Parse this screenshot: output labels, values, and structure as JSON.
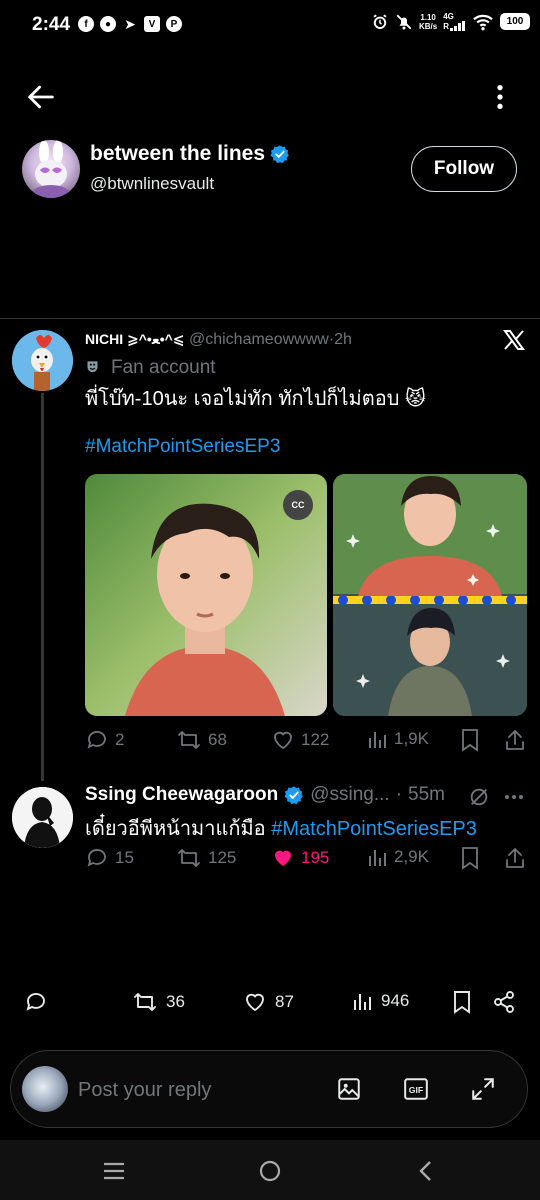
{
  "status_bar": {
    "time": "2:44",
    "net_speed_value": "1.10",
    "net_speed_unit": "KB/s",
    "network_type": "4G",
    "battery": "100"
  },
  "profile": {
    "display_name": "between the lines",
    "handle": "@btwnlinesvault",
    "follow_label": "Follow"
  },
  "embedded_tweet": {
    "author_name": "NICHI ⩾^•ﻌ•^⩽",
    "author_handle": "@chichameowwww",
    "separator": "·",
    "time": "2h",
    "fan_label": "Fan account",
    "text": "พี่โบ๊ท-10นะ เจอไม่ทัก ทักไปก็ไม่ตอบ 😾",
    "hashtag": "#MatchPointSeriesEP3",
    "media_badge": "CC",
    "stats": {
      "replies": "2",
      "reposts": "68",
      "likes": "122",
      "views": "1,9K"
    }
  },
  "quoted_reply": {
    "author_name": "Ssing Cheewagaroon",
    "author_handle": "@ssing...",
    "separator": "·",
    "time": "55m",
    "text": "เดี๋ยวอีพีหน้ามาแก้มือ",
    "hashtag": "#MatchPointSeriesEP3",
    "stats": {
      "replies": "15",
      "reposts": "125",
      "likes": "195",
      "views": "2,9K"
    }
  },
  "post_stats": {
    "reposts": "36",
    "likes": "87",
    "views": "946"
  },
  "reply_box": {
    "placeholder": "Post your reply"
  },
  "colors": {
    "accent_blue": "#1d9bf0",
    "like_pink": "#f91880",
    "background": "#000000"
  }
}
